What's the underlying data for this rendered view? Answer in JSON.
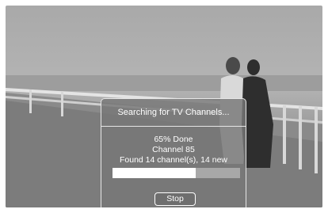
{
  "dialog": {
    "title": "Searching for TV Channels...",
    "progress_text": "65% Done",
    "channel_text": "Channel 85",
    "found_text": "Found 14 channel(s), 14 new",
    "progress_fraction": 0.65,
    "stop_label": "Stop"
  }
}
